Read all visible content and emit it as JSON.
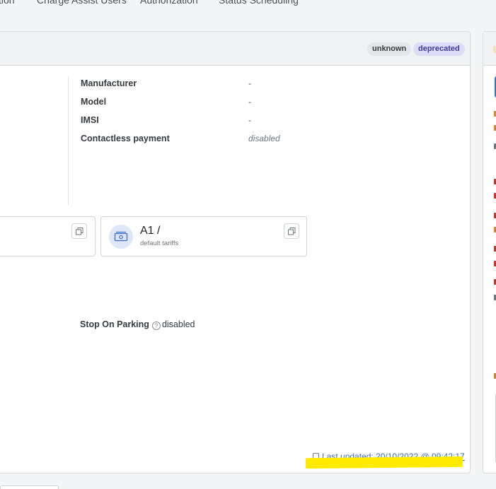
{
  "nav": {
    "tabs": [
      "tion",
      "Charge Assist Users",
      "Authorization",
      "Status Scheduling"
    ]
  },
  "badges": {
    "unknown": "unknown",
    "deprecated": "deprecated"
  },
  "properties": [
    {
      "label": "Manufacturer",
      "value": "-"
    },
    {
      "label": "Model",
      "value": "-"
    },
    {
      "label": "IMSI",
      "value": "-"
    },
    {
      "label": "Contactless payment",
      "value": "disabled"
    }
  ],
  "tariff_tile": {
    "title": "A1 /",
    "subtitle": "default tariffs",
    "icon": "money-icon"
  },
  "stop_on_parking": {
    "label": "Stop On Parking",
    "help": "?",
    "value": "disabled"
  },
  "last_updated": "Last updated: 20/10/2022 @ 09:42:17",
  "colors": {
    "primary": "#2f6fd6",
    "highlight": "#ffea00",
    "link": "#3a6fb0",
    "deprecated_bg": "#dcdcf7",
    "deprecated_text": "#3d3b9a"
  }
}
